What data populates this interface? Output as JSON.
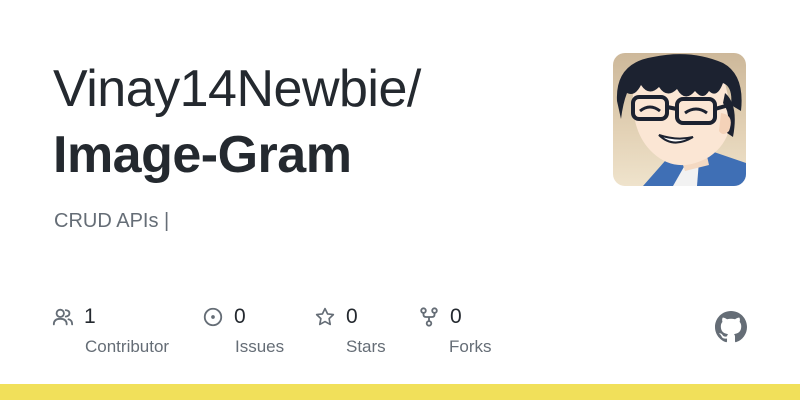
{
  "repo": {
    "owner": "Vinay14Newbie/",
    "name": "Image-Gram",
    "description": "CRUD APIs |"
  },
  "stats": {
    "contributors": {
      "value": "1",
      "label": "Contributor",
      "icon": "people-icon"
    },
    "issues": {
      "value": "0",
      "label": "Issues",
      "icon": "issue-circle-icon"
    },
    "stars": {
      "value": "0",
      "label": "Stars",
      "icon": "star-icon"
    },
    "forks": {
      "value": "0",
      "label": "Forks",
      "icon": "fork-icon"
    }
  },
  "colors": {
    "text": "#24292f",
    "muted": "#656d76",
    "language_bar": "#f1e05a"
  },
  "avatar": {
    "icon": "avatar-anime-character"
  },
  "logo": {
    "icon": "github-logo-icon"
  }
}
